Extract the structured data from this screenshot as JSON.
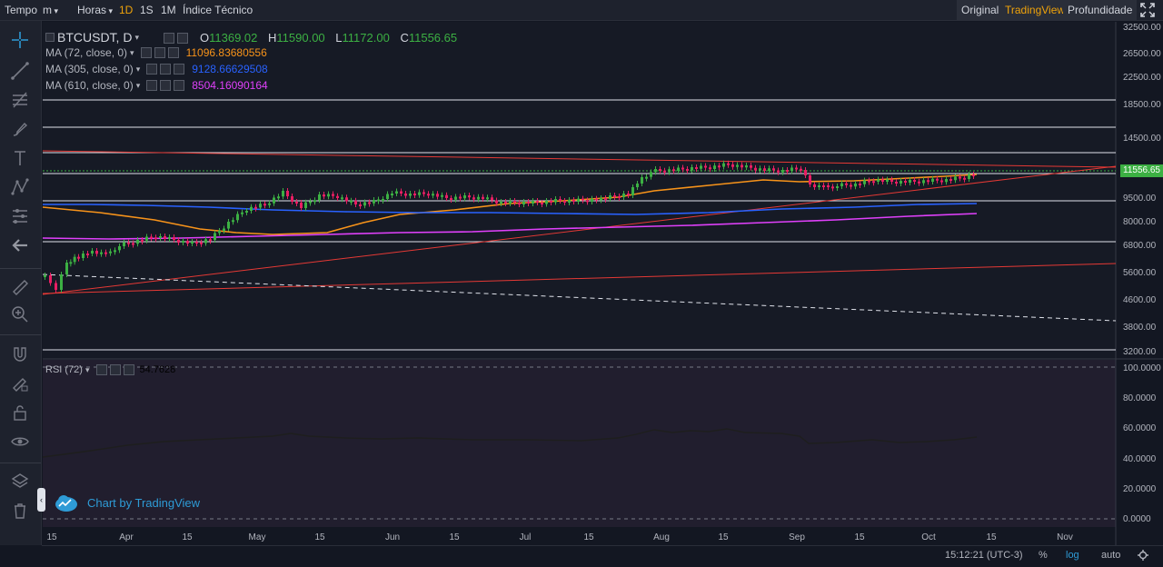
{
  "toolbar": {
    "time_label": "Tempo",
    "interval_value": "m",
    "hours_label": "Horas",
    "intervals": [
      "1D",
      "1S",
      "1M"
    ],
    "active_interval": "1D",
    "indicators_label": "Índice Técnico",
    "view_original": "Original",
    "view_tradingview": "TradingView",
    "view_depth": "Profundidade",
    "active_view": "TradingView"
  },
  "symbol": {
    "name": "BTCUSDT, D",
    "open_label": "O",
    "open": "11369.02",
    "high_label": "H",
    "high": "11590.00",
    "low_label": "L",
    "low": "11172.00",
    "close_label": "C",
    "close": "11556.65"
  },
  "indicators": [
    {
      "label": "MA (72, close, 0)",
      "value": "11096.83680556",
      "color": "#f7931a"
    },
    {
      "label": "MA (305, close, 0)",
      "value": "9128.66629508",
      "color": "#2962ff"
    },
    {
      "label": "MA (610, close, 0)",
      "value": "8504.16090164",
      "color": "#e040fb"
    }
  ],
  "rsi": {
    "label": "RSI (72)",
    "value": "54.7628"
  },
  "price_axis": [
    "32500.00",
    "26500.00",
    "22500.00",
    "18500.00",
    "14500.00",
    "11556.65",
    "9500.00",
    "8000.00",
    "6800.00",
    "5600.00",
    "4600.00",
    "3800.00",
    "3200.00"
  ],
  "rsi_axis": [
    "100.0000",
    "80.0000",
    "60.0000",
    "40.0000",
    "20.0000",
    "0.0000"
  ],
  "time_axis": [
    "15",
    "Apr",
    "15",
    "May",
    "15",
    "Jun",
    "15",
    "Jul",
    "15",
    "Aug",
    "15",
    "Sep",
    "15",
    "Oct",
    "15",
    "Nov"
  ],
  "last_price": "11556.65",
  "bottom": {
    "time": "15:12:21 (UTC-3)",
    "percent": "%",
    "log": "log",
    "auto": "auto"
  },
  "watermark": "Chart by TradingView",
  "colors": {
    "up": "#3cb043",
    "down": "#e91e63",
    "accent": "#f0a30a",
    "trendline": "#e53935"
  },
  "icons": [
    "crosshair-icon",
    "trend-line-icon",
    "fib-icon",
    "brush-icon",
    "text-icon",
    "pattern-icon",
    "prediction-icon",
    "back-arrow-icon",
    "ruler-icon",
    "zoom-icon",
    "magnet-icon",
    "lock-drawing-icon",
    "lock-icon",
    "eye-icon",
    "layers-icon",
    "trash-icon",
    "fullscreen-icon"
  ]
}
